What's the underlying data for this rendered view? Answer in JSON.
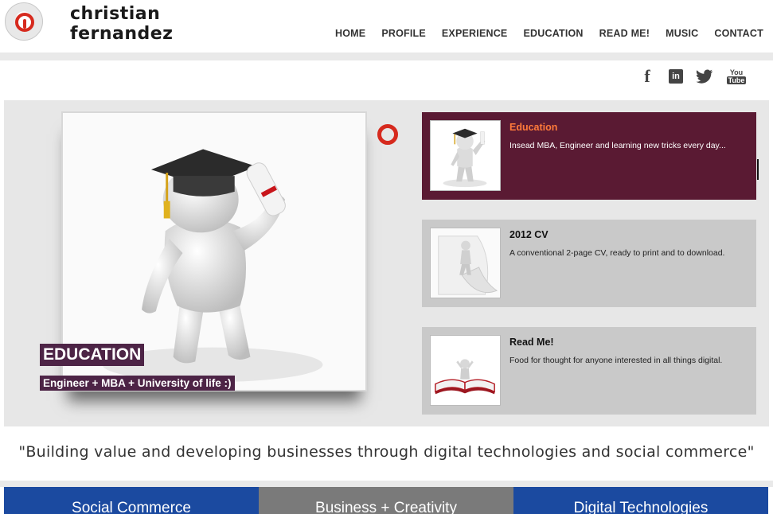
{
  "header": {
    "brand_line1": "christian",
    "brand_line2": "fernandez",
    "nav": [
      "HOME",
      "PROFILE",
      "EXPERIENCE",
      "EDUCATION",
      "READ ME!",
      "MUSIC",
      "CONTACT"
    ]
  },
  "social": {
    "facebook": "f",
    "linkedin": "in",
    "youtube_top": "You",
    "youtube_bottom": "Tube"
  },
  "hero": {
    "caption_title": "EDUCATION",
    "caption_subtitle": "Engineer + MBA + University of life :)"
  },
  "cards": [
    {
      "title": "Education",
      "desc": "Insead MBA, Engineer and learning new tricks every day..."
    },
    {
      "title": "2012 CV",
      "desc": "A conventional 2-page CV, ready to print and to download."
    },
    {
      "title": "Read Me!",
      "desc": "Food for thought for anyone interested in all things digital."
    }
  ],
  "quote": "\"Building value and developing businesses through digital technologies and social commerce\"",
  "tabs": [
    "Social Commerce",
    "Business + Creativity",
    "Digital Technologies"
  ],
  "colors": {
    "accent_red": "#d62a1e",
    "plum": "#5a1a33",
    "caption": "#4d2446",
    "tab_blue": "#1b4aa0",
    "tab_gray": "#7a7a7a",
    "card_title_active": "#ff7a3a"
  },
  "icons": [
    "logo-target-icon",
    "facebook-icon",
    "linkedin-icon",
    "twitter-icon",
    "youtube-icon",
    "slider-ring-icon"
  ]
}
